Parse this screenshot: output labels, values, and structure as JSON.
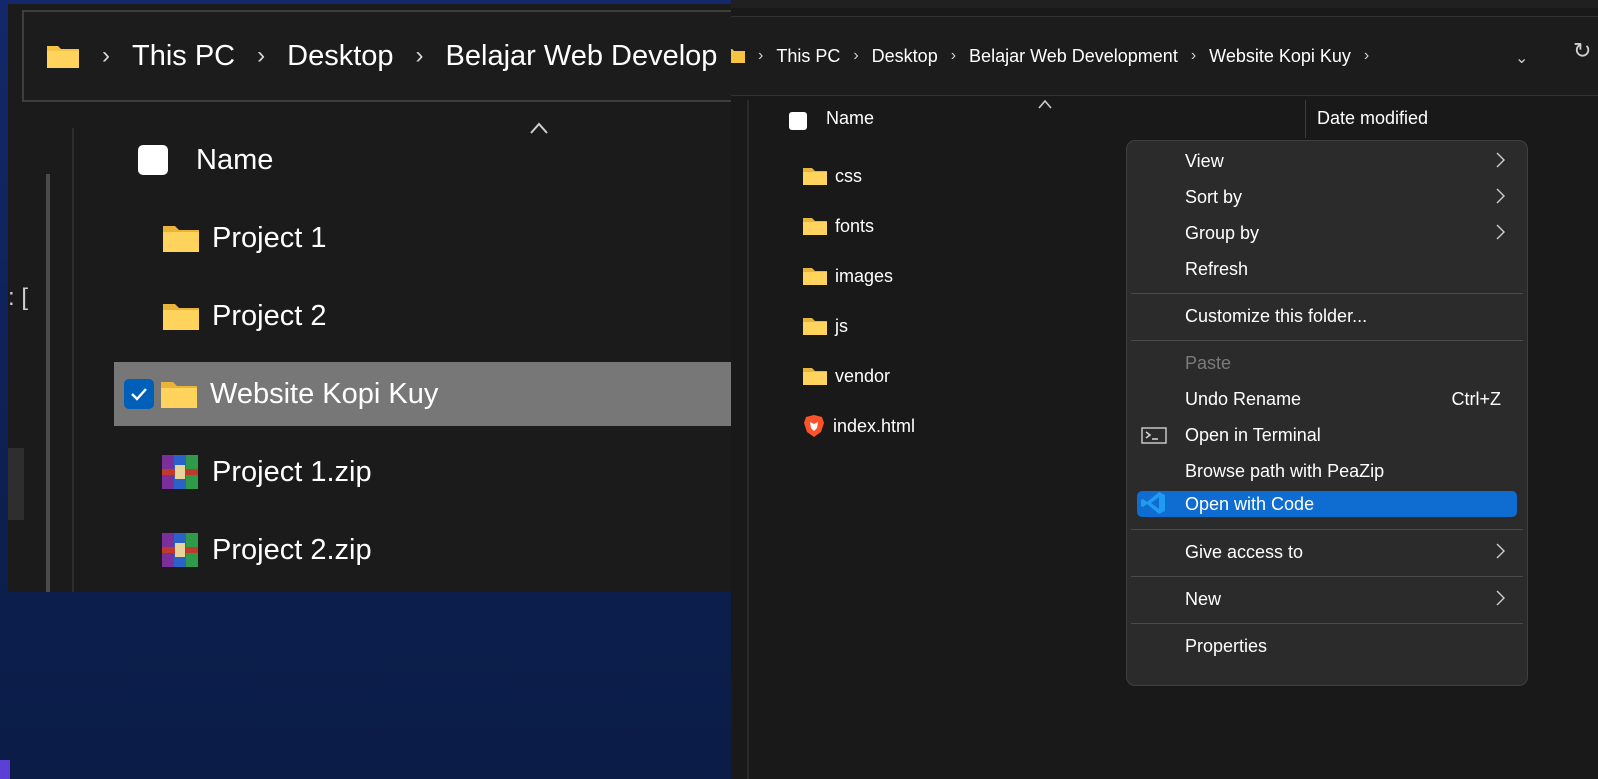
{
  "left": {
    "breadcrumb": [
      "This PC",
      "Desktop",
      "Belajar Web Develop"
    ],
    "stub_text": ": [",
    "column_name": "Name",
    "items": [
      {
        "label": "Project 1",
        "type": "folder",
        "selected": false
      },
      {
        "label": "Project 2",
        "type": "folder",
        "selected": false
      },
      {
        "label": "Website Kopi Kuy",
        "type": "folder",
        "selected": true
      },
      {
        "label": "Project 1.zip",
        "type": "zip",
        "selected": false
      },
      {
        "label": "Project 2.zip",
        "type": "zip",
        "selected": false
      }
    ]
  },
  "right": {
    "breadcrumb": [
      "This PC",
      "Desktop",
      "Belajar Web Development",
      "Website Kopi Kuy"
    ],
    "columns": {
      "name": "Name",
      "date_modified": "Date modified"
    },
    "files": [
      {
        "label": "css",
        "type": "folder"
      },
      {
        "label": "fonts",
        "type": "folder"
      },
      {
        "label": "images",
        "type": "folder"
      },
      {
        "label": "js",
        "type": "folder"
      },
      {
        "label": "vendor",
        "type": "folder"
      },
      {
        "label": "index.html",
        "type": "html-brave"
      }
    ]
  },
  "context_menu": {
    "items": [
      {
        "label": "View",
        "submenu": true
      },
      {
        "label": "Sort by",
        "submenu": true
      },
      {
        "label": "Group by",
        "submenu": true
      },
      {
        "label": "Refresh"
      },
      {
        "label": "Customize this folder..."
      },
      {
        "label": "Paste",
        "disabled": true
      },
      {
        "label": "Undo Rename",
        "shortcut": "Ctrl+Z"
      },
      {
        "label": "Open in Terminal",
        "icon": "terminal-icon"
      },
      {
        "label": "Browse path with PeaZip"
      },
      {
        "label": "Open with Code",
        "icon": "vscode-icon",
        "highlighted": true
      },
      {
        "label": "Give access to",
        "submenu": true
      },
      {
        "label": "New",
        "submenu": true
      },
      {
        "label": "Properties"
      }
    ]
  },
  "colors": {
    "folder": "#f5c542",
    "highlight": "#0f6cd1",
    "checkbox_selected": "#005fb8",
    "selected_row": "#777777"
  }
}
